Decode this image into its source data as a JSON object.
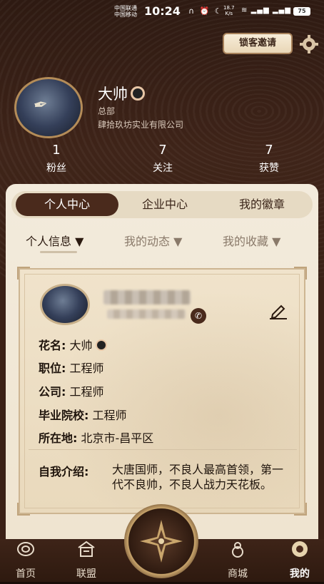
{
  "status_bar": {
    "carrier_1": "中国联通",
    "carrier_2": "中国移动",
    "time": "10:24",
    "speed_value": "18.7",
    "speed_unit": "K/s",
    "battery": "75"
  },
  "header": {
    "invite_button": "锁客邀请",
    "user_name": "大帅",
    "department": "总部",
    "company": "肆拾玖坊实业有限公司"
  },
  "stats": [
    {
      "value": "1",
      "label": "粉丝"
    },
    {
      "value": "7",
      "label": "关注"
    },
    {
      "value": "7",
      "label": "获赞"
    }
  ],
  "main_tabs": [
    "个人中心",
    "企业中心",
    "我的徽章"
  ],
  "sub_tabs": [
    {
      "label": "个人信息 ▼"
    },
    {
      "label": "我的动态 ▼"
    },
    {
      "label": "我的收藏 ▼"
    }
  ],
  "profile": {
    "fields": [
      {
        "key": "花名:",
        "value": "大帅"
      },
      {
        "key": "职位:",
        "value": "工程师"
      },
      {
        "key": "公司:",
        "value": "工程师"
      },
      {
        "key": "毕业院校:",
        "value": "工程师"
      },
      {
        "key": "所在地:",
        "value": "北京市-昌平区"
      }
    ],
    "intro_key": "自我介绍:",
    "intro_value": "大唐国师，不良人最高首领，第一代不良帅，不良人战力天花板。"
  },
  "bottom_nav": [
    "首页",
    "联盟",
    "商城",
    "我的"
  ],
  "colors": {
    "dark_brown": "#4a2a1c",
    "card_bg": "#f3ebdc",
    "accent_gold": "#b48c58"
  }
}
